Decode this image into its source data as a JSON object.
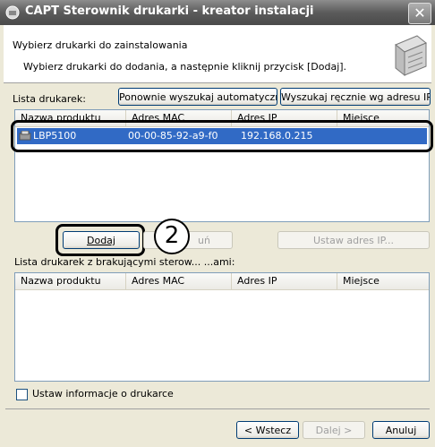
{
  "window": {
    "title": "CAPT Sterownik drukarki - kreator instalacji",
    "close_glyph": "✕",
    "app_icon": "printer-icon"
  },
  "header": {
    "heading": "Wybierz drukarki do zainstalowania",
    "subheading": "Wybierz drukarki do dodania, a następnie kliknij przycisk [Dodaj]."
  },
  "printer_list": {
    "label": "Lista drukarek:",
    "rescan_button": "Ponownie wyszukaj automatycznie",
    "manual_search_button": "Wyszukaj ręcznie wg adresu IP...",
    "columns": [
      "Nazwa produktu",
      "Adres MAC",
      "Adres IP",
      "Miejsce"
    ],
    "rows": [
      {
        "name": "LBP5100",
        "mac": "00-00-85-92-a9-f0",
        "ip": "192.168.0.215",
        "place": "",
        "selected": true
      }
    ]
  },
  "actions": {
    "add_button": "Dodaj",
    "remove_button_partial": "uń",
    "set_ip_button": "Ustaw adres IP...",
    "callout_number": "2"
  },
  "missing_list": {
    "label": "Lista drukarek z brakującymi sterow... ...ami:",
    "columns": [
      "Nazwa produktu",
      "Adres MAC",
      "Adres IP",
      "Miejsce"
    ],
    "rows": []
  },
  "options": {
    "set_printer_info_label": "Ustaw informacje o drukarce",
    "set_printer_info_checked": false
  },
  "nav": {
    "back_button": "< Wstecz",
    "next_button": "Dalej >",
    "cancel_button": "Anuluj"
  }
}
